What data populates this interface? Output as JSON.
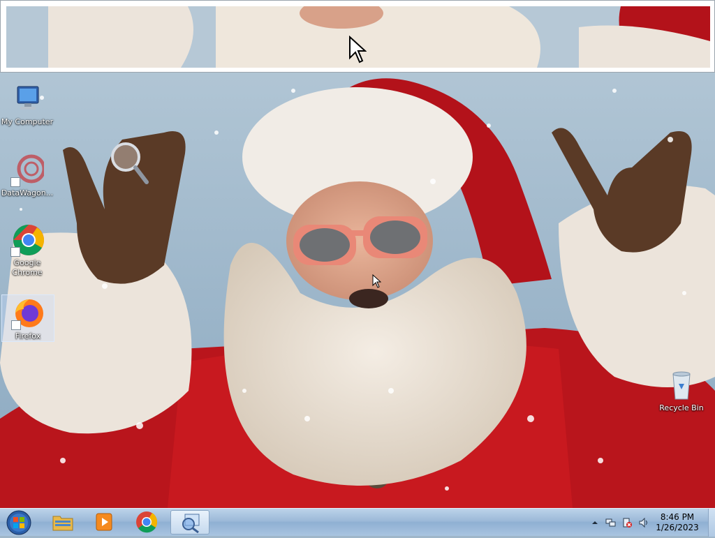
{
  "desktop": {
    "icons": [
      {
        "label": "My Computer",
        "icon": "computer-icon",
        "shortcut": false,
        "selected": false
      },
      {
        "label": "DataWagon...",
        "icon": "datawagon-icon",
        "shortcut": true,
        "selected": false
      },
      {
        "label": "Google Chrome",
        "icon": "chrome-icon",
        "shortcut": true,
        "selected": false
      },
      {
        "label": "Firefox",
        "icon": "firefox-icon",
        "shortcut": true,
        "selected": true
      },
      {
        "label": "Recycle Bin",
        "icon": "recycle-bin-icon",
        "shortcut": false,
        "selected": false
      }
    ]
  },
  "magnifier": {
    "mode": "docked"
  },
  "taskbar": {
    "start": {
      "icon": "windows-start-orb-icon"
    },
    "pinned": [
      {
        "icon": "file-explorer-icon",
        "active": false
      },
      {
        "icon": "media-player-icon",
        "active": false
      },
      {
        "icon": "chrome-icon",
        "active": false
      },
      {
        "icon": "magnifier-icon",
        "active": true
      }
    ],
    "tray": {
      "icons": [
        "show-hidden-icons-icon",
        "network-icon",
        "action-center-alert-icon",
        "volume-icon"
      ]
    },
    "clock": {
      "time": "8:46 PM",
      "date": "1/26/2023"
    }
  },
  "colors": {
    "taskbar": "#9cb9d8",
    "santa_red": "#c8191f",
    "sky": "#a9c0d3"
  }
}
